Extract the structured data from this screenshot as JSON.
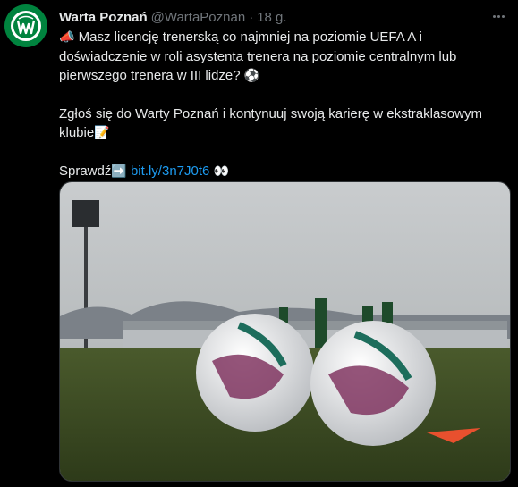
{
  "tweet": {
    "author_name": "Warta Poznań",
    "author_handle": "@WartaPoznan",
    "separator": "·",
    "timestamp": "18 g.",
    "text_line1_icon": "📣",
    "text_line1": " Masz licencję trenerską co najmniej na poziomie UEFA A i doświadczenie w roli asystenta trenera na poziomie centralnym lub pierwszego trenera w III lidze? ",
    "text_line1_end_icon": "⚽",
    "text_line2": "Zgłoś się do Warty Poznań i kontynuuj swoją karierę w ekstraklasowym klubie",
    "text_line2_end_icon": "📝",
    "text_line3": "Sprawdź",
    "text_line3_arrow_icon": "➡️",
    "link_text": "bit.ly/3n7J0t6",
    "eyes_icon": "👀",
    "avatar_logo_text": "WARTA POZNAŃ",
    "avatar_year": "1912"
  },
  "icons": {
    "more": "more-options-icon",
    "media": "football-photo"
  },
  "colors": {
    "background": "#000000",
    "text": "#e7e9ea",
    "muted": "#71767b",
    "link": "#1d9bf0",
    "club_green": "#00833e"
  }
}
